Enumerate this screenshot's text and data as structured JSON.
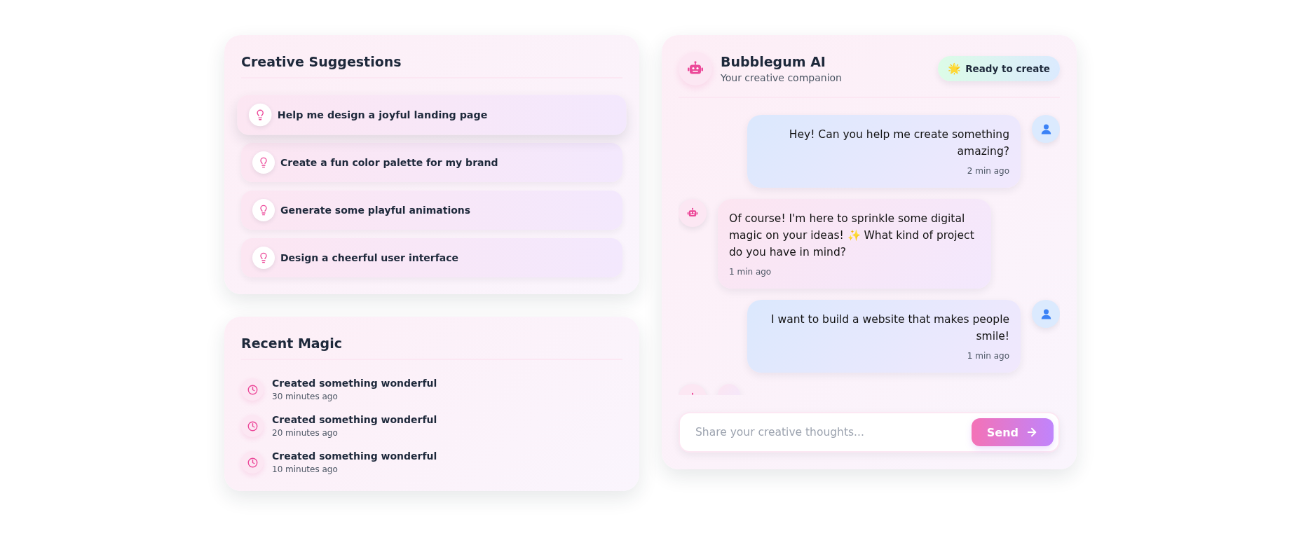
{
  "suggestions_panel": {
    "title": "Creative Suggestions",
    "items": [
      {
        "text": "Help me design a joyful landing page",
        "highlighted": true
      },
      {
        "text": "Create a fun color palette for my brand",
        "highlighted": false
      },
      {
        "text": "Generate some playful animations",
        "highlighted": false
      },
      {
        "text": "Design a cheerful user interface",
        "highlighted": false
      }
    ]
  },
  "recent_panel": {
    "title": "Recent Magic",
    "items": [
      {
        "title": "Created something wonderful",
        "time": "30 minutes ago"
      },
      {
        "title": "Created something wonderful",
        "time": "20 minutes ago"
      },
      {
        "title": "Created something wonderful",
        "time": "10 minutes ago"
      }
    ]
  },
  "chat": {
    "title": "Bubblegum AI",
    "subtitle": "Your creative companion",
    "status": {
      "icon": "🌟",
      "label": "Ready to create"
    },
    "messages": [
      {
        "kind": "user",
        "text": "Hey! Can you help me create something amazing?",
        "time": "2 min ago"
      },
      {
        "kind": "bot",
        "text": "Of course! I'm here to sprinkle some digital magic on your ideas! ✨ What kind of project do you have in mind?",
        "time": "1 min ago"
      },
      {
        "kind": "user",
        "text": "I want to build a website that makes people smile!",
        "time": "1 min ago"
      },
      {
        "kind": "bot"
      }
    ],
    "input": {
      "placeholder": "Share your creative thoughts..."
    },
    "send_button": {
      "label": "Send"
    }
  }
}
